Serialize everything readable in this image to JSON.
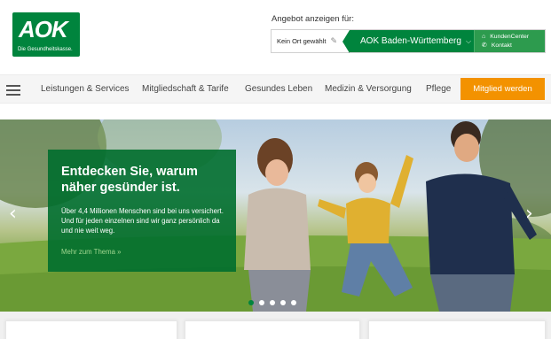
{
  "logo": {
    "mark": "AOK",
    "tagline": "Die Gesundheitskasse."
  },
  "region": {
    "label": "Angebot anzeigen für:",
    "place": "Kein Ort gewählt",
    "name": "AOK Baden-Württemberg",
    "links": [
      {
        "label": "KundenCenter",
        "icon": "home-icon"
      },
      {
        "label": "Kontakt",
        "icon": "phone-icon"
      }
    ]
  },
  "nav": {
    "items": [
      "Leistungen & Services",
      "Mitgliedschaft & Tarife",
      "Gesundes Leben",
      "Medizin & Versorgung",
      "Pflege"
    ],
    "cta": "Mitglied werden"
  },
  "hero": {
    "title": "Entdecken Sie, warum näher gesünder ist.",
    "text": "Über 4,4 Millionen Menschen sind bei uns versichert. Und für jeden einzelnen sind wir ganz persönlich da und nie weit weg.",
    "link": "Mehr zum Thema »",
    "slide_count": 5,
    "active_slide": 1
  },
  "colors": {
    "brand": "#00843d",
    "cta": "#f39200"
  }
}
